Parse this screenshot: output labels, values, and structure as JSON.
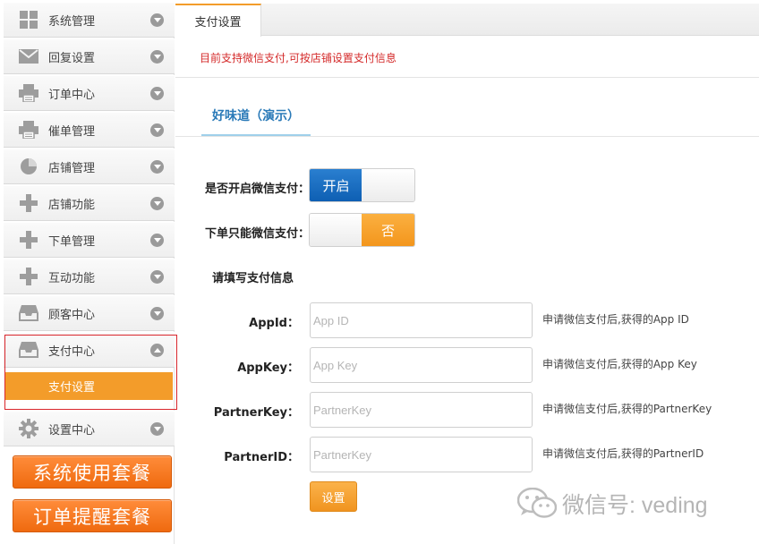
{
  "sidebar": {
    "items": [
      {
        "label": "系统管理",
        "icon": "grid-icon"
      },
      {
        "label": "回复设置",
        "icon": "envelope-icon"
      },
      {
        "label": "订单中心",
        "icon": "printer-icon"
      },
      {
        "label": "催单管理",
        "icon": "printer-icon"
      },
      {
        "label": "店铺管理",
        "icon": "pie-chart-icon"
      },
      {
        "label": "店铺功能",
        "icon": "plus-icon"
      },
      {
        "label": "下单管理",
        "icon": "plus-icon"
      },
      {
        "label": "互动功能",
        "icon": "plus-icon"
      },
      {
        "label": "顾客中心",
        "icon": "inbox-icon"
      },
      {
        "label": "支付中心",
        "icon": "inbox-icon"
      },
      {
        "label": "设置中心",
        "icon": "gear-icon"
      }
    ],
    "active_sub": "支付设置",
    "package_buttons": [
      "系统使用套餐",
      "订单提醒套餐"
    ]
  },
  "main": {
    "tab": "支付设置",
    "notice": "目前支持微信支付,可按店铺设置支付信息",
    "store_tab": "好味道（演示）",
    "toggles": [
      {
        "label": "是否开启微信支付：",
        "on_text": "开启",
        "state": "on"
      },
      {
        "label": "下单只能微信支付：",
        "off_text": "否",
        "state": "off"
      }
    ],
    "section_title": "请填写支付信息",
    "fields": [
      {
        "label": "AppId：",
        "placeholder": "App ID",
        "hint": "申请微信支付后,获得的App ID"
      },
      {
        "label": "AppKey：",
        "placeholder": "App Key",
        "hint": "申请微信支付后,获得的App Key"
      },
      {
        "label": "PartnerKey：",
        "placeholder": "PartnerKey",
        "hint": "申请微信支付后,获得的PartnerKey"
      },
      {
        "label": "PartnerID：",
        "placeholder": "PartnerKey",
        "hint": "申请微信支付后,获得的PartnerID"
      }
    ],
    "submit_label": "设置"
  },
  "watermark": {
    "text": "微信号: veding"
  },
  "colors": {
    "accent_orange": "#f39c2a",
    "toggle_blue": "#0e5fb3",
    "notice_red": "#d42a2a",
    "highlight_red": "#d9262c"
  }
}
